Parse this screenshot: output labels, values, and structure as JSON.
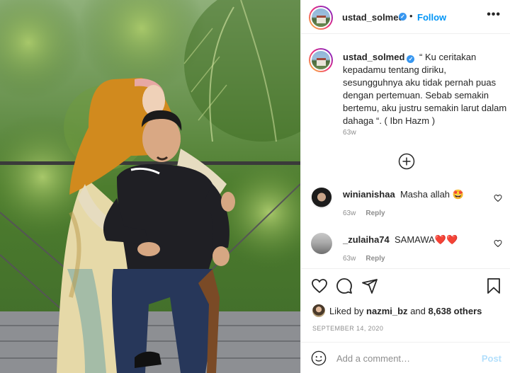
{
  "post": {
    "author": "ustad_solmed",
    "verified": true,
    "follow_label": "Follow",
    "dot_separator": "•",
    "more_label": "•••",
    "caption_text": "“ Ku ceritakan kepadamu tentang diriku, sesungguhnya aku tidak pernah puas dengan pertemuan. Sebab semakin bertemu, aku justru semakin larut dalam dahaga “. ( Ibn Hazm )",
    "caption_time": "63w",
    "load_more_icon": "plus-circle-icon"
  },
  "comments": [
    {
      "username": "winianishaa",
      "text": "Masha allah 🤩",
      "time": "63w",
      "reply_label": "Reply"
    },
    {
      "username": "_zulaiha74",
      "text": "SAMAWA❤️❤️",
      "time": "63w",
      "reply_label": "Reply"
    }
  ],
  "actions": {
    "icons": [
      "heart-icon",
      "comment-icon",
      "share-icon",
      "bookmark-icon"
    ],
    "liked_by_prefix": "Liked by",
    "liked_by_user": "nazmi_bz",
    "liked_by_and": "and",
    "likes_count": "8,638 others",
    "date": "SEPTEMBER 14, 2020"
  },
  "add_comment": {
    "placeholder": "Add a comment…",
    "post_label": "Post",
    "emoji_icon": "emoji-icon"
  },
  "colors": {
    "link_blue": "#0095f6",
    "post_disabled": "#b2dffc",
    "muted_text": "#8e8e8e",
    "border": "#efefef"
  }
}
